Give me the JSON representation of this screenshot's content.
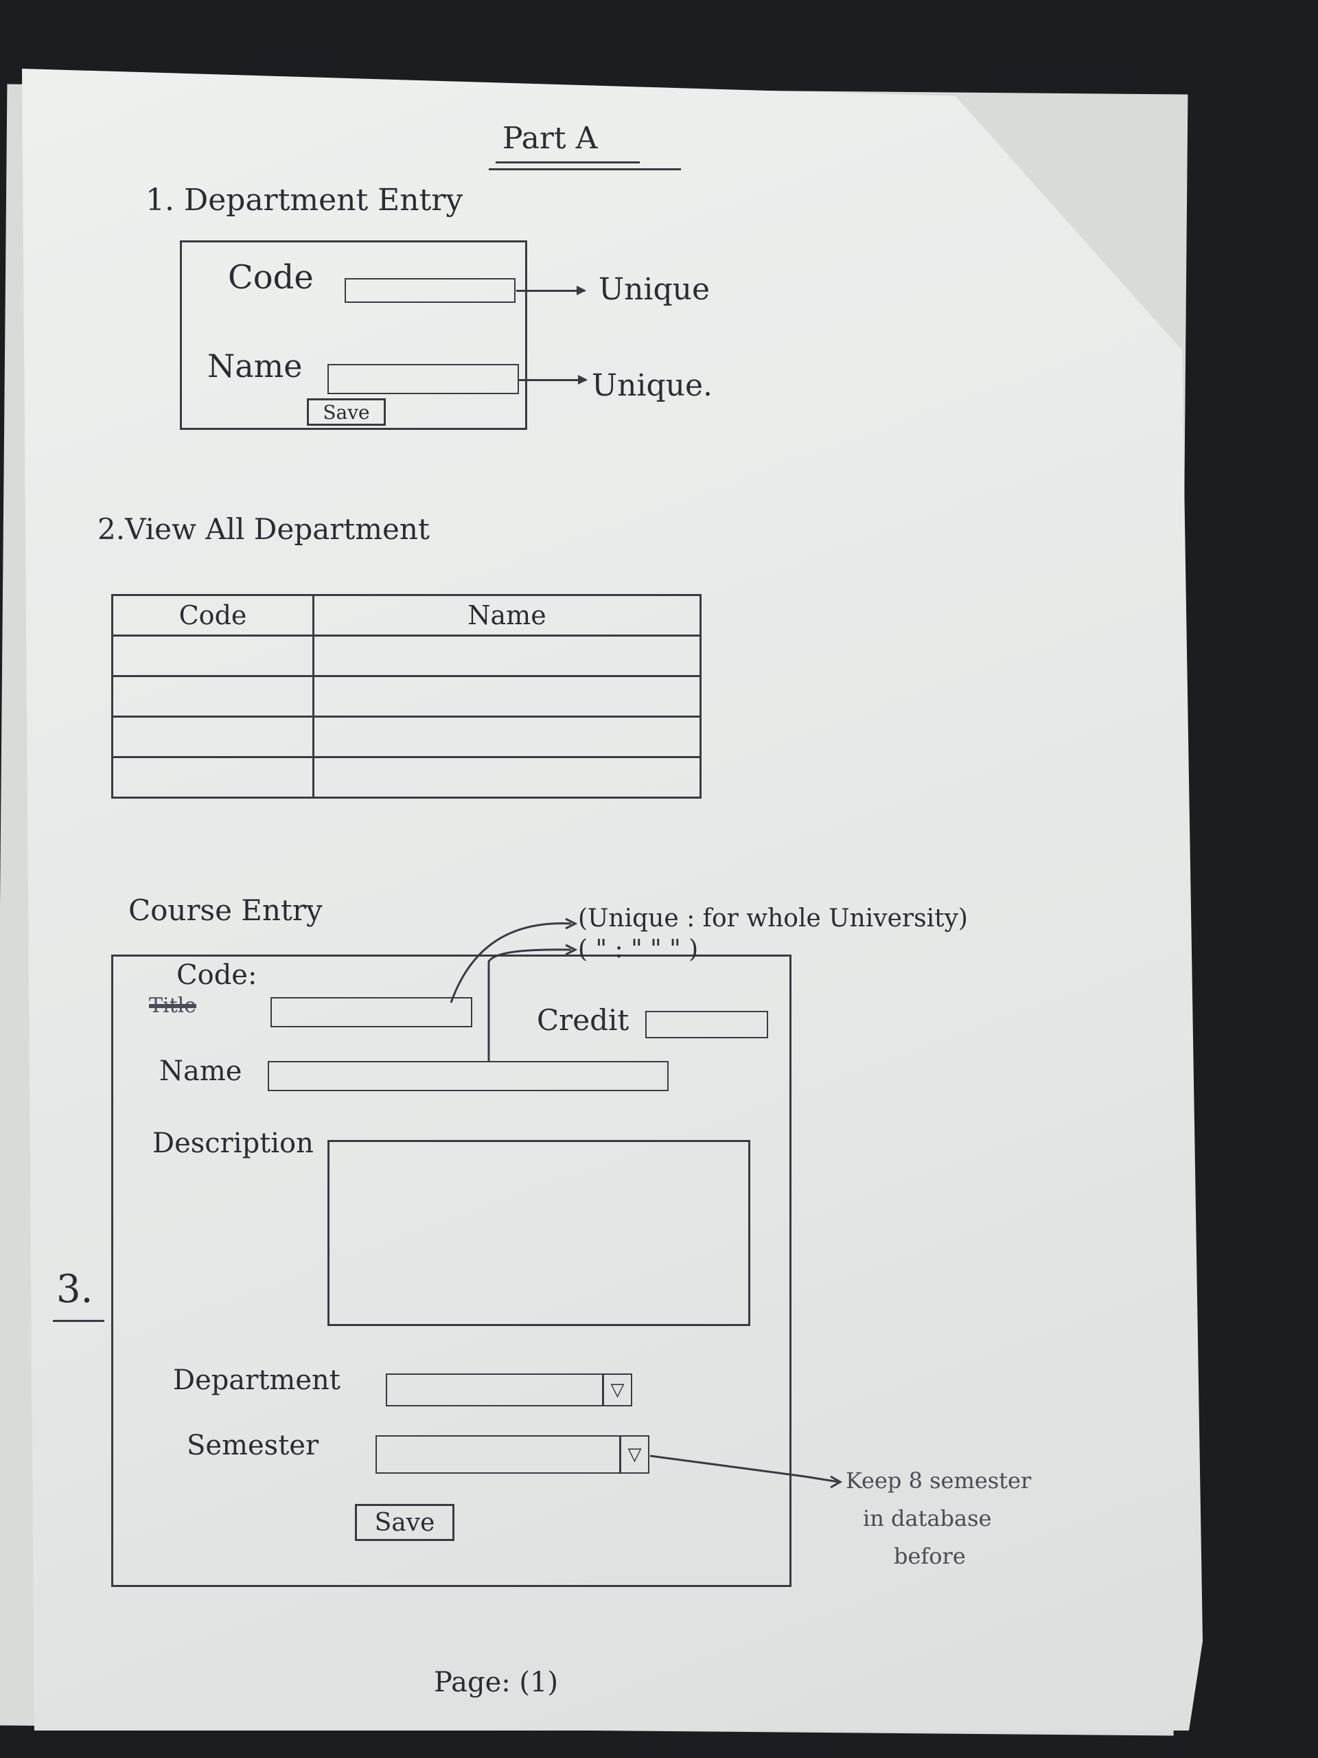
{
  "header": {
    "title": "Part A"
  },
  "section1": {
    "heading": "1. Department Entry",
    "code_label": "Code",
    "name_label": "Name",
    "save_label": "Save",
    "code_note": "Unique",
    "name_note": "Unique."
  },
  "section2": {
    "heading": "2.View All Department",
    "columns": [
      "Code",
      "Name"
    ],
    "rows": 4
  },
  "section3": {
    "number": "3.",
    "heading": "Course Entry",
    "code_label": "Code:",
    "struck_label": "Title",
    "credit_label": "Credit",
    "name_label": "Name",
    "description_label": "Description",
    "department_label": "Department",
    "semester_label": "Semester",
    "save_label": "Save",
    "unique_note": "(Unique : for whole University)",
    "ditto_note": "(   \"   :   \"        \"        \"    )",
    "semester_note_line1": "Keep 8 semester",
    "semester_note_line2": "in database",
    "semester_note_line3": "before",
    "dropdown_icon": "triangle-down"
  },
  "footer": {
    "page_label": "Page: (1)"
  }
}
